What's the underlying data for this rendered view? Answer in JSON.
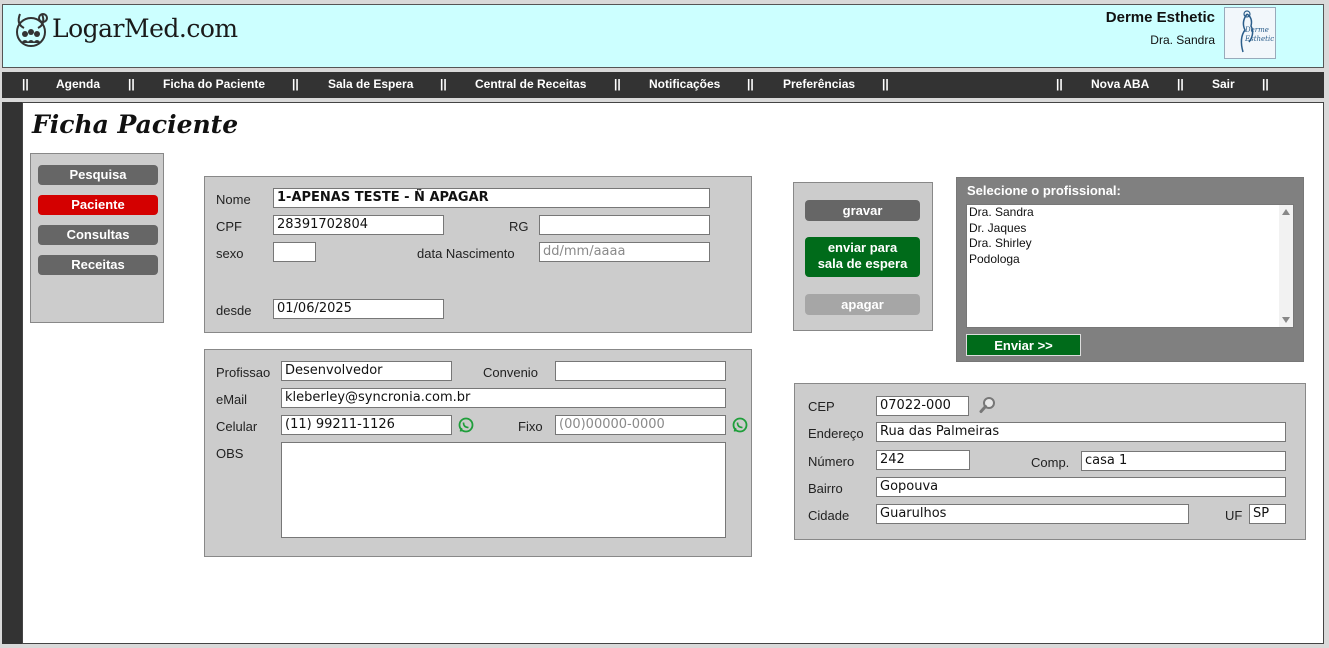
{
  "header": {
    "logo_text": "LogarMed.com",
    "clinic_name": "Derme Esthetic",
    "clinic_doctor": "Dra. Sandra",
    "clinic_logo_text": "Derme Esthetic"
  },
  "nav": {
    "separator": "||",
    "items": [
      "Agenda",
      "Ficha do Paciente",
      "Sala de Espera",
      "Central de Receitas",
      "Notificações",
      "Preferências"
    ],
    "right_items": [
      "Nova ABA",
      "Sair"
    ]
  },
  "page": {
    "title": "Ficha Paciente"
  },
  "sidebar": {
    "items": [
      {
        "label": "Pesquisa",
        "active": false
      },
      {
        "label": "Paciente",
        "active": true
      },
      {
        "label": "Consultas",
        "active": false
      },
      {
        "label": "Receitas",
        "active": false
      }
    ]
  },
  "patient": {
    "nome_label": "Nome",
    "nome_value": "1-APENAS TESTE - Ñ APAGAR",
    "cpf_label": "CPF",
    "cpf_value": "28391702804",
    "rg_label": "RG",
    "rg_value": "",
    "sexo_label": "sexo",
    "sexo_value": "",
    "nasc_label": "data Nascimento",
    "nasc_placeholder": "dd/mm/aaaa",
    "desde_label": "desde",
    "desde_value": "01/06/2025"
  },
  "contact": {
    "profissao_label": "Profissao",
    "profissao_value": "Desenvolvedor",
    "convenio_label": "Convenio",
    "convenio_value": "",
    "email_label": "eMail",
    "email_value": "kleberley@syncronia.com.br",
    "celular_label": "Celular",
    "celular_value": "(11) 99211-1126",
    "fixo_label": "Fixo",
    "fixo_placeholder": "(00)00000-0000",
    "obs_label": "OBS",
    "obs_value": "",
    "whatsapp_icon": "whatsapp-icon"
  },
  "actions": {
    "gravar": "gravar",
    "enviar_line1": "enviar para",
    "enviar_line2": "sala de espera",
    "apagar": "apagar"
  },
  "professionals": {
    "title": "Selecione o profissional:",
    "items": [
      "Dra. Sandra",
      "Dr. Jaques",
      "Dra. Shirley",
      "Podologa"
    ],
    "send_button": "Enviar >>"
  },
  "address": {
    "cep_label": "CEP",
    "cep_value": "07022-000",
    "endereco_label": "Endereço",
    "endereco_value": "Rua das Palmeiras",
    "numero_label": "Número",
    "numero_value": "242",
    "comp_label": "Comp.",
    "comp_value": "casa 1",
    "bairro_label": "Bairro",
    "bairro_value": "Gopouva",
    "cidade_label": "Cidade",
    "cidade_value": "Guarulhos",
    "uf_label": "UF",
    "uf_value": "SP",
    "search_icon": "search-icon"
  },
  "colors": {
    "header_bg": "#ccffff",
    "nav_bg": "#333333",
    "active_red": "#d40000",
    "action_green": "#006b1a",
    "panel_gray": "#cccccc"
  }
}
